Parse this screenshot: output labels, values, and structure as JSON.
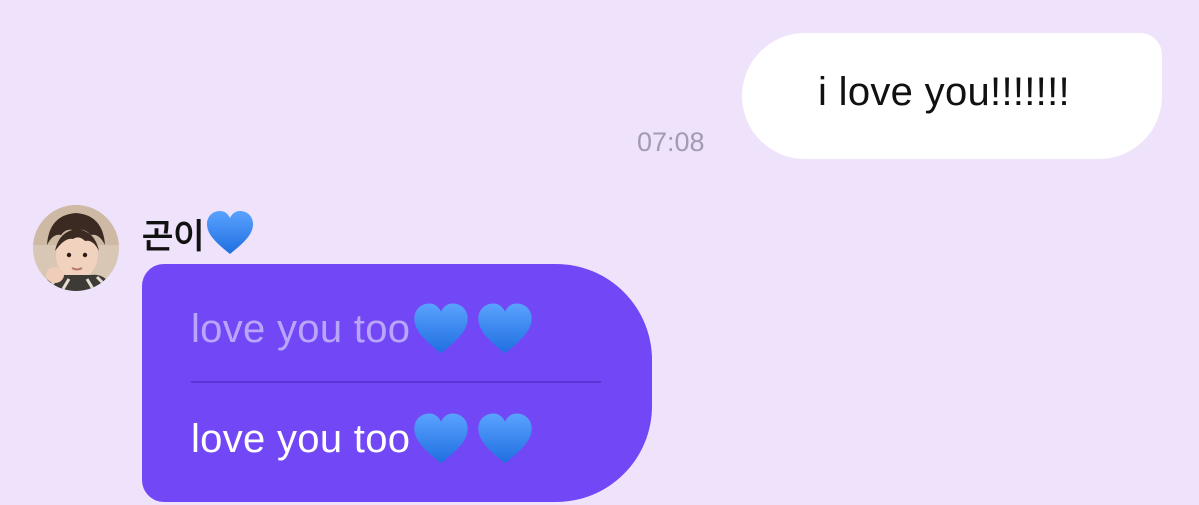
{
  "sent_message": {
    "text": "i love you!!!!!!!",
    "time": "07:08"
  },
  "received_message": {
    "sender_name": "곤이",
    "sender_heart_icon": "blue-heart-icon",
    "quoted_text": "love you too",
    "reply_text": "love you too",
    "heart_icon": "blue-heart-icon"
  },
  "colors": {
    "background": "#efe3fb",
    "sent_bubble": "#ffffff",
    "received_bubble": "#7247f6",
    "heart": "#3d8cf5"
  }
}
